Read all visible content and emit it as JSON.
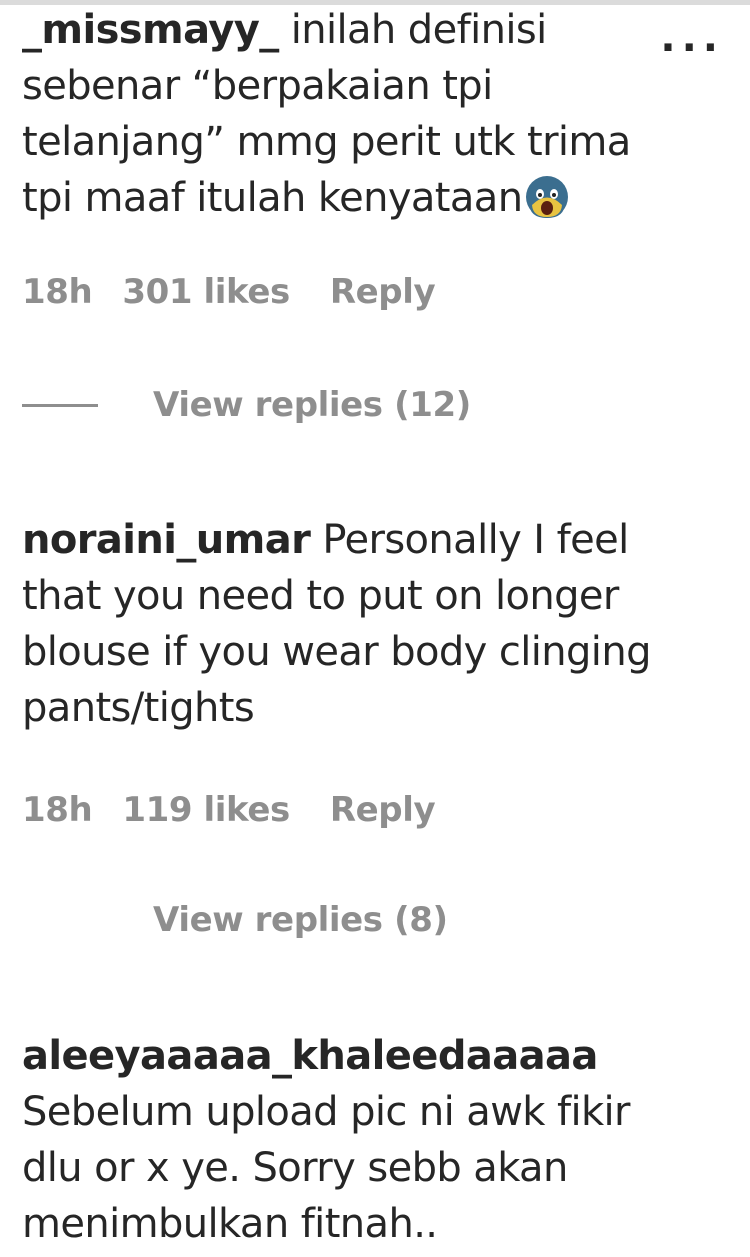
{
  "comments": [
    {
      "username": "_missmayy_",
      "text": " inilah definisi sebenar “berpakaian tpi telanjang” mmg perit utk trima tpi maaf itulah kenyataan",
      "emoji": "face-screaming-emoji",
      "time": "18h",
      "likes": "301 likes",
      "reply": "Reply",
      "view_replies": "View replies (12)"
    },
    {
      "username": "noraini_umar",
      "text": " Personally I feel that you need to put on longer blouse if you wear body clinging pants/tights",
      "time": "18h",
      "likes": "119 likes",
      "reply": "Reply",
      "view_replies": "View replies (8)"
    },
    {
      "username": "aleeyaaaaa_khaleedaaaaa",
      "text": "Sebelum upload pic ni awk fikir dlu or x ye. Sorry sebb akan menimbulkan fitnah.."
    }
  ],
  "more_options": "..."
}
